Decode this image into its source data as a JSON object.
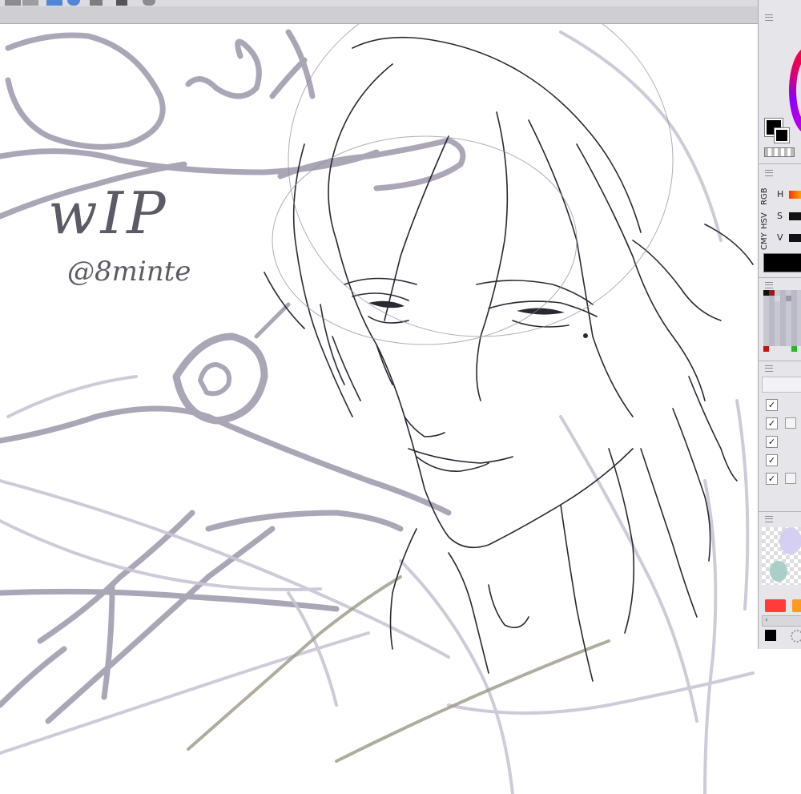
{
  "app": {
    "accent": "#1e6fd0",
    "panel_bg": "#e6e6ea",
    "toolbar_bg": "#cfcfd3"
  },
  "toolbar": {
    "icons": [
      "tool-icon",
      "selection-icon",
      "lasso-icon",
      "ruler-icon",
      "layer-icon",
      "speech-icon"
    ]
  },
  "canvas": {
    "watermark_line1": "wIP",
    "watermark_line2": "@8minte",
    "sketch_colors": {
      "line": "#2a2833",
      "rough": "#9d97aa",
      "rough_light": "#c9c5d4",
      "olive": "#9c9886"
    }
  },
  "color_panel": {
    "mode_tabs": [
      "RGB",
      "HSV",
      "CMY"
    ],
    "sliders": [
      {
        "label": "H",
        "color": "#ff6600"
      },
      {
        "label": "S",
        "color": "#111111"
      },
      {
        "label": "V",
        "color": "#111111"
      }
    ],
    "foreground": "#000000",
    "background": "#000000"
  },
  "layers": {
    "rows": [
      {
        "checked": "✓",
        "has_aux": false
      },
      {
        "checked": "✓",
        "has_aux": true
      },
      {
        "checked": "✓",
        "has_aux": false
      },
      {
        "checked": "✓",
        "has_aux": false
      },
      {
        "checked": "✓",
        "has_aux": true
      }
    ]
  },
  "scratchpad": {
    "chips": [
      "#ff3333",
      "#ff9922"
    ],
    "scroll_arrow": "‹"
  }
}
